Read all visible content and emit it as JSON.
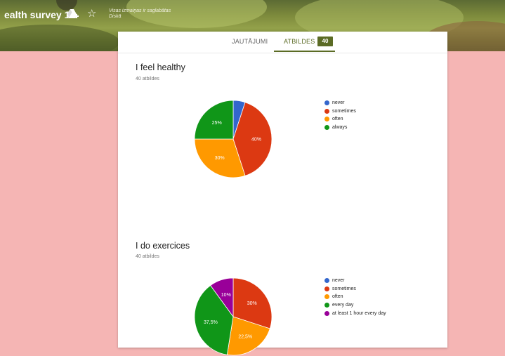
{
  "header": {
    "title": "ealth survey 1",
    "save_note_line1": "Visas izmaiņas ir saglabātas",
    "save_note_line2": "Diskā",
    "drive_icon": "drive-add-icon",
    "star_icon": "star-outline-icon"
  },
  "tabs": {
    "questions": "JAUTĀJUMI",
    "responses": "ATBILDES",
    "responses_count": "40"
  },
  "colors": {
    "accent": "#5b6b25",
    "blue": "#3366cc",
    "red": "#dc3912",
    "orange": "#ff9900",
    "green": "#109618",
    "purple": "#990099",
    "background": "#f5b5b4"
  },
  "questions": [
    {
      "title": "I feel healthy",
      "responses": "40 atbildes",
      "chart_data": {
        "type": "pie",
        "categories": [
          "never",
          "sometimes",
          "often",
          "always"
        ],
        "values": [
          5,
          40,
          30,
          25
        ],
        "labels": [
          "",
          "40%",
          "30%",
          "25%"
        ],
        "colors": [
          "#3366cc",
          "#dc3912",
          "#ff9900",
          "#109618"
        ]
      }
    },
    {
      "title": "I do exercices",
      "responses": "40 atbildes",
      "chart_data": {
        "type": "pie",
        "categories": [
          "never",
          "sometimes",
          "often",
          "every day",
          "at least 1 hour every day"
        ],
        "values": [
          0,
          30,
          22.5,
          37.5,
          10
        ],
        "labels": [
          "",
          "30%",
          "22,5%",
          "37,5%",
          "10%"
        ],
        "colors": [
          "#3366cc",
          "#dc3912",
          "#ff9900",
          "#109618",
          "#990099"
        ]
      }
    }
  ]
}
